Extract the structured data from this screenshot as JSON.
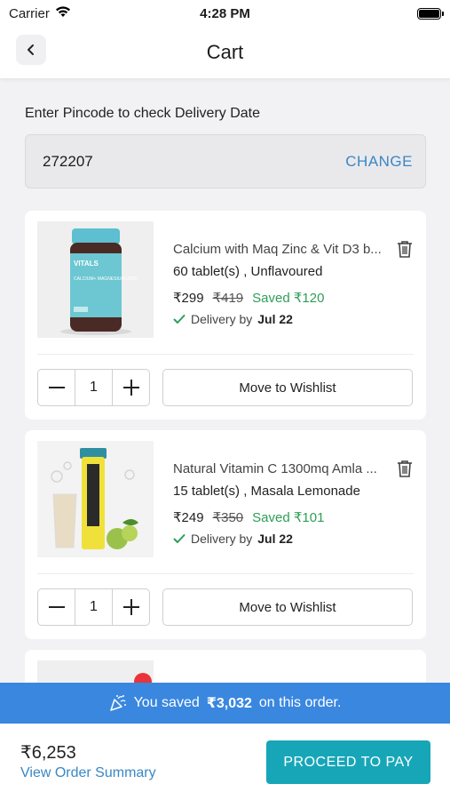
{
  "status_bar": {
    "carrier": "Carrier",
    "time": "4:28 PM"
  },
  "header": {
    "title": "Cart"
  },
  "pincode": {
    "label": "Enter Pincode to check Delivery Date",
    "value": "272207",
    "change_label": "CHANGE"
  },
  "cart_items": [
    {
      "name": "Calcium with Maq Zinc & Vit D3 b...",
      "variant": "60 tablet(s) , Unflavoured",
      "price": "₹299",
      "mrp": "₹419",
      "saved": "Saved ₹120",
      "delivery_label": "Delivery by",
      "delivery_date": "Jul 22",
      "quantity": "1",
      "wishlist_label": "Move to Wishlist",
      "thumb_brand": "VITALS",
      "thumb_text": "CALCIUM+ MAGNESIUM+ZINC"
    },
    {
      "name": "Natural Vitamin C 1300mq Amla ...",
      "variant": "15 tablet(s) , Masala Lemonade",
      "price": "₹249",
      "mrp": "₹350",
      "saved": "Saved ₹101",
      "delivery_label": "Delivery by",
      "delivery_date": "Jul 22",
      "quantity": "1",
      "wishlist_label": "Move to Wishlist"
    }
  ],
  "savings": {
    "prefix": "You saved",
    "amount": "₹3,032",
    "suffix": "on this order."
  },
  "footer": {
    "total": "₹6,253",
    "summary_link": "View Order Summary",
    "proceed_label": "PROCEED TO PAY"
  },
  "colors": {
    "accent_blue": "#3a87c5",
    "banner_blue": "#3a87e0",
    "saved_green": "#2e9e58",
    "proceed_teal": "#17a6b8"
  }
}
